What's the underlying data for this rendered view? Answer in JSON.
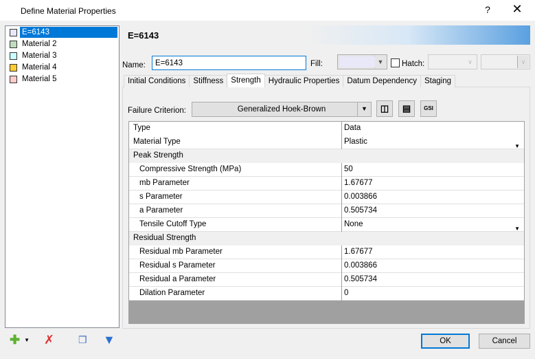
{
  "window": {
    "title": "Define Material Properties",
    "help": "?",
    "close": "✕"
  },
  "materials": [
    {
      "label": "E=6143",
      "color": "#e8e8f8",
      "selected": true
    },
    {
      "label": "Material 2",
      "color": "#c0dcc0"
    },
    {
      "label": "Material 3",
      "color": "#ccffff"
    },
    {
      "label": "Material 4",
      "color": "#ffcc33"
    },
    {
      "label": "Material 5",
      "color": "#ffcccc"
    }
  ],
  "header": {
    "title": "E=6143"
  },
  "name": {
    "label": "Name:",
    "value": "E=6143"
  },
  "fill": {
    "label": "Fill:",
    "color": "#e8e8f8"
  },
  "hatch": {
    "label": "Hatch:",
    "checked": false
  },
  "tabs": [
    {
      "label": "Initial Conditions"
    },
    {
      "label": "Stiffness"
    },
    {
      "label": "Strength",
      "active": true
    },
    {
      "label": "Hydraulic Properties"
    },
    {
      "label": "Datum Dependency"
    },
    {
      "label": "Staging"
    }
  ],
  "failure": {
    "label": "Failure Criterion:",
    "value": "Generalized Hoek-Brown",
    "gsi_label": "GSI"
  },
  "grid": {
    "headers": [
      "Type",
      "Data"
    ],
    "rows": [
      {
        "type": "row",
        "name": "Material Type",
        "value": "Plastic",
        "dropdown": true
      },
      {
        "type": "group",
        "name": "Peak Strength"
      },
      {
        "type": "ind",
        "name": "Compressive Strength (MPa)",
        "value": "50"
      },
      {
        "type": "ind",
        "name": "mb Parameter",
        "value": "1.67677"
      },
      {
        "type": "ind",
        "name": "s Parameter",
        "value": "0.003866"
      },
      {
        "type": "ind",
        "name": "a Parameter",
        "value": "0.505734"
      },
      {
        "type": "ind",
        "name": "Tensile Cutoff Type",
        "value": "None",
        "dropdown": true
      },
      {
        "type": "group",
        "name": "Residual Strength"
      },
      {
        "type": "ind",
        "name": "Residual mb Parameter",
        "value": "1.67677"
      },
      {
        "type": "ind",
        "name": "Residual s Parameter",
        "value": "0.003866"
      },
      {
        "type": "ind",
        "name": "Residual a Parameter",
        "value": "0.505734"
      },
      {
        "type": "ind",
        "name": "Dilation Parameter",
        "value": "0"
      }
    ]
  },
  "buttons": {
    "ok": "OK",
    "cancel": "Cancel"
  }
}
